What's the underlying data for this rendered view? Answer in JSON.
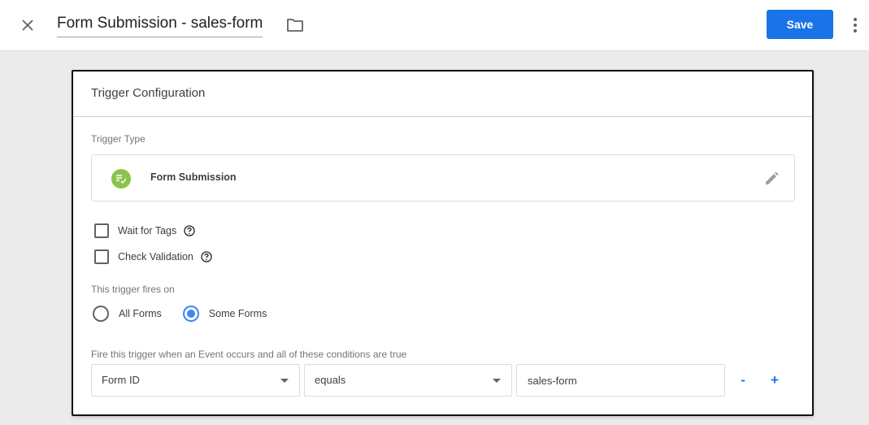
{
  "header": {
    "title": "Form Submission - sales-form",
    "save_label": "Save"
  },
  "icons": {
    "close": "close-icon",
    "folder": "folder-icon",
    "more": "more-vert-icon",
    "trigger_type": "form-submission-icon",
    "edit": "pencil-icon",
    "help": "help-circle-icon"
  },
  "colors": {
    "primary": "#1a73e8",
    "radio_selected": "#4285f4",
    "trigger_icon": "#8bc34a"
  },
  "card": {
    "title": "Trigger Configuration",
    "trigger_type_label": "Trigger Type",
    "trigger_type": "Form Submission",
    "options": [
      {
        "label": "Wait for Tags",
        "checked": false
      },
      {
        "label": "Check Validation",
        "checked": false
      }
    ],
    "fires_on_label": "This trigger fires on",
    "fires_on": [
      {
        "label": "All Forms",
        "selected": false
      },
      {
        "label": "Some Forms",
        "selected": true
      }
    ],
    "condition_label": "Fire this trigger when an Event occurs and all of these conditions are true",
    "condition": {
      "variable": "Form ID",
      "operator": "equals",
      "value": "sales-form",
      "remove_label": "-",
      "add_label": "+"
    }
  }
}
